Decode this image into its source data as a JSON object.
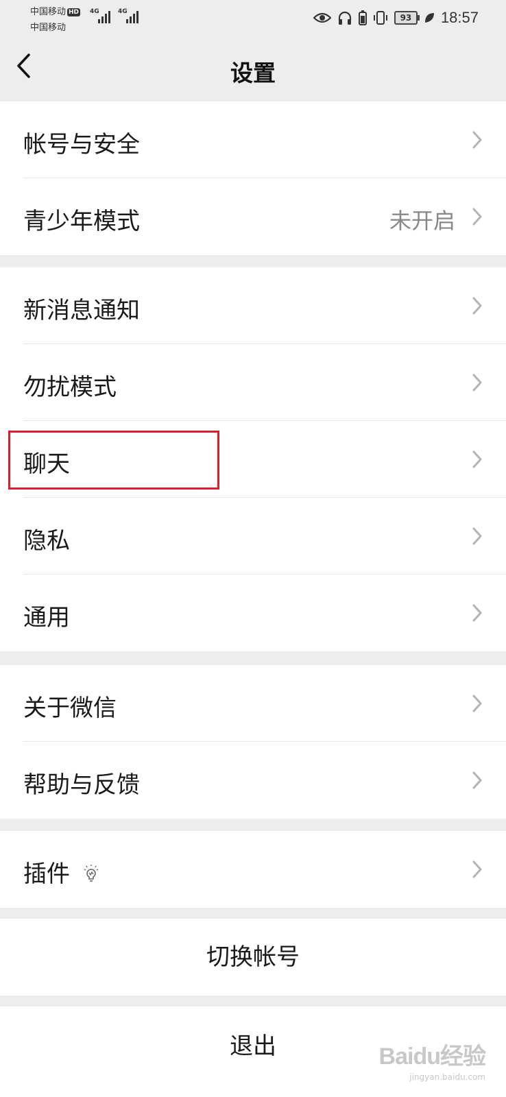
{
  "status_bar": {
    "carrier_1": "中国移动",
    "carrier_1_badge": "HD",
    "carrier_2": "中国移动",
    "network_1": "4G",
    "network_2": "4G",
    "battery": "93",
    "time": "18:57"
  },
  "nav": {
    "title": "设置",
    "back_icon": "chevron-left-icon"
  },
  "groups": {
    "account": [
      {
        "label": "帐号与安全",
        "value": ""
      },
      {
        "label": "青少年模式",
        "value": "未开启"
      }
    ],
    "settings": [
      {
        "label": "新消息通知"
      },
      {
        "label": "勿扰模式"
      },
      {
        "label": "聊天"
      },
      {
        "label": "隐私"
      },
      {
        "label": "通用"
      }
    ],
    "about": [
      {
        "label": "关于微信"
      },
      {
        "label": "帮助与反馈"
      }
    ],
    "plugins": [
      {
        "label": "插件",
        "icon": "bulb-icon"
      }
    ]
  },
  "actions": {
    "switch_account": "切换帐号",
    "logout": "退出"
  },
  "highlight_target": "聊天",
  "watermark": {
    "main": "Baidu经验",
    "sub": "jingyan.baidu.com"
  },
  "colors": {
    "page_background": "#ededed",
    "cell_background": "#ffffff",
    "highlight_border": "#d9202a",
    "secondary_text": "#888888"
  }
}
